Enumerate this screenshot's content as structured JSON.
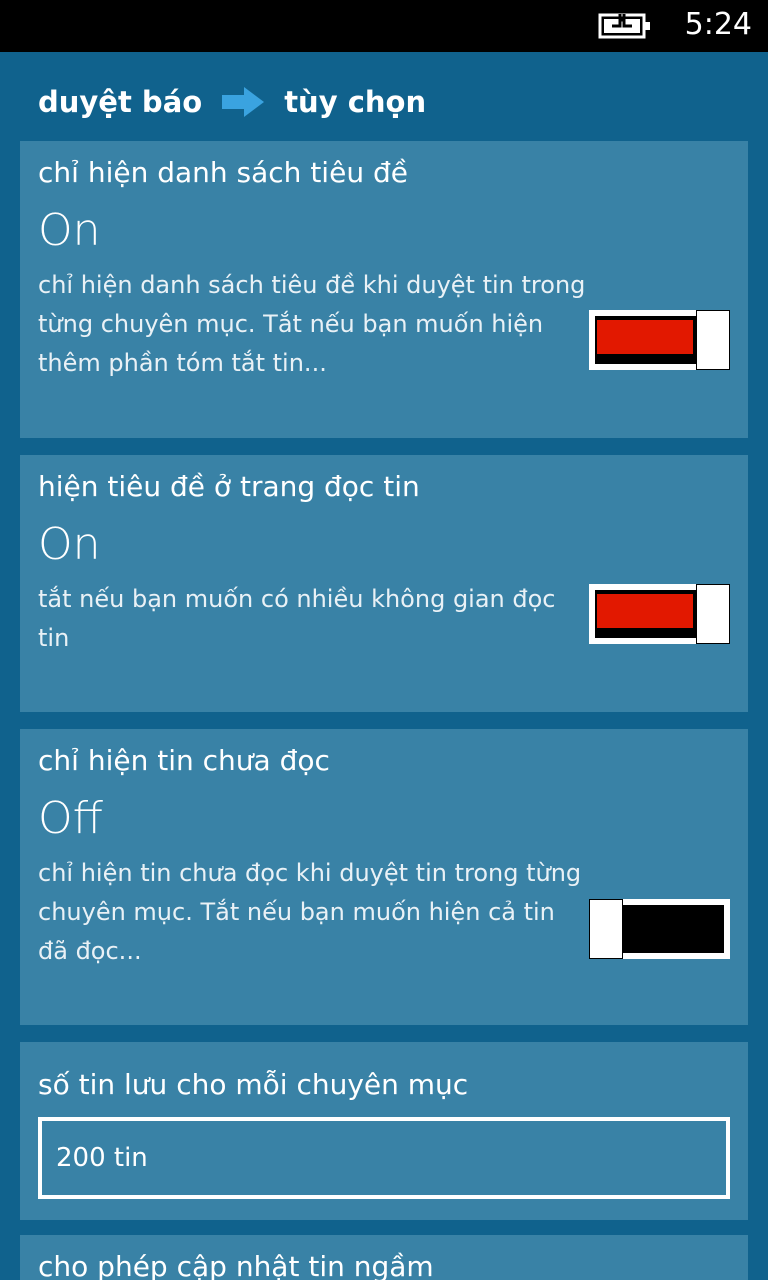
{
  "status_bar": {
    "time": "5:24",
    "battery_icon": "battery-charging-icon"
  },
  "header": {
    "parent": "duyệt báo",
    "arrow_icon": "arrow-right-icon",
    "current": "tùy chọn"
  },
  "settings": [
    {
      "title": "chỉ hiện danh sách tiêu đề",
      "state": "On",
      "description": "chỉ hiện danh sách tiêu đề khi duyệt tin trong từng chuyên mục. Tắt nếu bạn muốn hiện thêm phần tóm tắt tin...",
      "enabled": true
    },
    {
      "title": "hiện tiêu đề ở trang đọc tin",
      "state": "On",
      "description": "tắt nếu bạn muốn có nhiều không gian đọc tin",
      "enabled": true
    },
    {
      "title": "chỉ hiện tin chưa đọc",
      "state": "Off",
      "description": "chỉ hiện tin chưa đọc khi duyệt tin trong từng chuyên mục. Tắt nếu bạn muốn hiện cả tin đã đọc...",
      "enabled": false
    }
  ],
  "storage": {
    "title": "số tin lưu cho mỗi chuyên mục",
    "value": "200 tin"
  },
  "background_update": {
    "title": "cho phép cập nhật tin ngầm"
  },
  "colors": {
    "background": "#10628d",
    "panel": "#3982a6",
    "toggle_on": "#e21800",
    "toggle_off": "#000000"
  }
}
